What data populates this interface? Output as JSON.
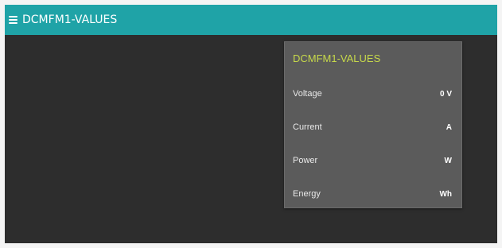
{
  "header": {
    "menu_icon": "hamburger-menu-icon",
    "title": "DCMFM1-VALUES",
    "background_color": "#1fa3a7"
  },
  "card": {
    "title": "DCMFM1-VALUES",
    "title_color": "#c7d94a",
    "rows": [
      {
        "label": "Voltage",
        "value": "0 V"
      },
      {
        "label": "Current",
        "value": "A"
      },
      {
        "label": "Power",
        "value": "W"
      },
      {
        "label": "Energy",
        "value": "Wh"
      }
    ]
  }
}
